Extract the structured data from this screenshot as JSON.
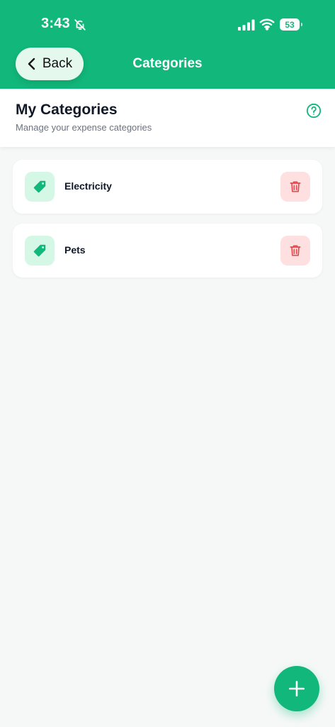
{
  "status_bar": {
    "time": "3:43",
    "battery": "53",
    "icons": [
      "bell-slash-icon",
      "signal-icon",
      "wifi-icon",
      "battery-icon"
    ]
  },
  "nav": {
    "back_label": "Back",
    "title": "Categories"
  },
  "header": {
    "title": "My Categories",
    "description": "Manage your expense categories"
  },
  "categories": [
    {
      "label": "Electricity",
      "icon": "tag-icon"
    },
    {
      "label": "Pets",
      "icon": "tag-icon"
    }
  ],
  "colors": {
    "brand": "#12b87b",
    "tag_bg": "#d5f7e6",
    "delete_bg": "#fde0df",
    "delete_icon": "#e5484d"
  }
}
